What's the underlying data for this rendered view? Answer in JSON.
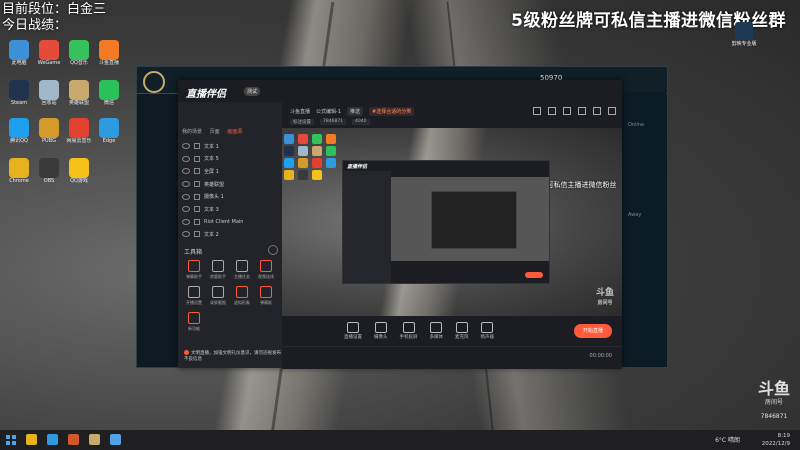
{
  "overlay": {
    "top_left_line1": "目前段位：白金三",
    "top_left_line2": "今日战绩：",
    "top_right": "5级粉丝牌可私信主播进微信粉丝群",
    "room_id": "7846871"
  },
  "desktop_icons": [
    {
      "label": "此电脑",
      "color": "#3d8fd6"
    },
    {
      "label": "WeGame",
      "color": "#e64a3b"
    },
    {
      "label": "QQ音乐",
      "color": "#35c25d"
    },
    {
      "label": "斗鱼直播",
      "color": "#f07b22"
    },
    {
      "label": "Steam",
      "color": "#20324d"
    },
    {
      "label": "回收站",
      "color": "#9fb8cc"
    },
    {
      "label": "英雄联盟",
      "color": "#c8aa6e"
    },
    {
      "label": "微信",
      "color": "#2ac15a"
    },
    {
      "label": "腾讯QQ",
      "color": "#1ea0ee"
    },
    {
      "label": "PUBG",
      "color": "#d49a2a"
    },
    {
      "label": "网易云音乐",
      "color": "#e2412f"
    },
    {
      "label": "Edge",
      "color": "#2e9be0"
    },
    {
      "label": "Chrome",
      "color": "#e6b31f"
    },
    {
      "label": "OBS",
      "color": "#3a3a3a"
    },
    {
      "label": "QQ游戏",
      "color": "#f5c21b"
    }
  ],
  "app": {
    "logo": "直播伴侣",
    "badge": "测试",
    "side_tabs": [
      "我的场景",
      "页面",
      "画面源"
    ],
    "scenes": [
      "文本 1",
      "文本 5",
      "全屏 1",
      "英雄联盟",
      "摄像头 1",
      "文本 3",
      "Riot Client Main",
      "文本 2"
    ],
    "tools_title": "工具箱",
    "tools": [
      "弹幕助手",
      "房管助手",
      "主播任务",
      "视频连线",
      "开播设置",
      "录屏截图",
      "虚拟形象",
      "弹幕姬",
      "新功能"
    ],
    "notice": "文明直播，加强文明礼仪意识，请勿违规发布不良信息",
    "main_tabs": [
      "斗鱼直播",
      "公式编辑-1",
      "推送",
      "#选择合适的分类"
    ],
    "main_sub": [
      "标注设置",
      "7846871",
      "4040"
    ],
    "preview_caption": "5级粉丝牌可私信主播进微信粉丝群",
    "preview_watermark": "斗鱼",
    "preview_watermark_sub": "房间号",
    "bottom_tools": [
      "直播设置",
      "摄像头",
      "手机投屏",
      "多媒体",
      "麦克风",
      "扬声器"
    ],
    "start_button": "开始直播",
    "status_right": "00:00:00"
  },
  "lol": {
    "coin": "50970",
    "right_panel": [
      "Online",
      "Away"
    ]
  },
  "right_desktop_icon": {
    "label": "剪映专业版"
  },
  "douyu": {
    "name": "斗鱼",
    "sub": "房间号",
    "id": "7846871"
  },
  "taskbar": {
    "apps": [
      {
        "color": "#e6b31f"
      },
      {
        "color": "#2e9be0"
      },
      {
        "color": "#d4572a"
      },
      {
        "color": "#c8aa6e"
      },
      {
        "color": "#4fa3e6"
      }
    ],
    "weather": "6°C 晴朗",
    "time": "8:19",
    "date": "2022/12/9"
  }
}
